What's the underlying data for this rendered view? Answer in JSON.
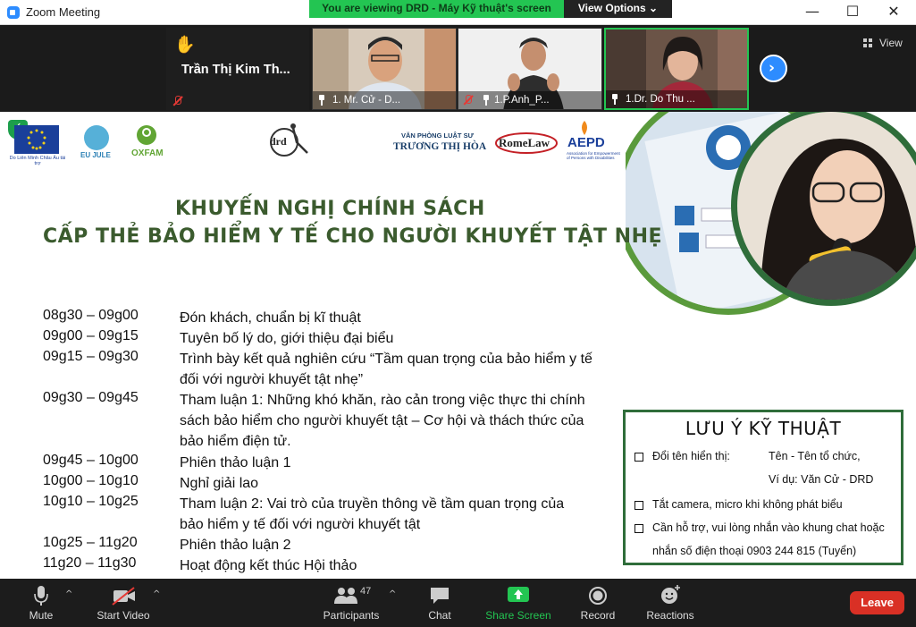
{
  "window": {
    "title": "Zoom Meeting",
    "viewing_banner": "You are viewing DRD - Máy Kỹ thuật's screen",
    "view_options_label": "View Options",
    "minimize": "—",
    "maximize": "☐",
    "close": "✕"
  },
  "participants_strip": {
    "raised_hand_name": "Trần Thị Kim Th...",
    "tiles": [
      {
        "name": "1. Mr. Cử - D..."
      },
      {
        "name": "1.P.Anh_P..."
      },
      {
        "name": "1.Dr. Do Thu ..."
      }
    ],
    "view_label": "View"
  },
  "slide": {
    "logos": {
      "eu_caption": "Do Liên Minh Châu Âu tài trợ",
      "eujule": "EU JULE",
      "oxfam": "OXFAM",
      "drd": "drd",
      "law_office_line1": "VĂN PHÒNG LUẬT SƯ",
      "law_office_line2": "TRƯƠNG THỊ HÒA",
      "romelaw": "RomeLaw",
      "aepd": "AEPD",
      "aepd_caption": "Association for Empowerment of Persons with Disabilities"
    },
    "title_line1": "KHUYẾN NGHỊ CHÍNH SÁCH",
    "title_line2": "CẤP THẺ BẢO HIỂM Y TẾ CHO NGƯỜI KHUYẾT TẬT NHẸ",
    "agenda": [
      {
        "time": "08g30 – 09g00",
        "text": "Đón khách, chuẩn bị kĩ thuật"
      },
      {
        "time": "09g00 – 09g15",
        "text": "Tuyên bố lý do, giới thiệu đại biểu"
      },
      {
        "time": "09g15 – 09g30",
        "text": "Trình bày kết quả nghiên cứu “Tầm quan trọng của bảo hiểm y tế đối với người khuyết tật nhẹ”"
      },
      {
        "time": "09g30 – 09g45",
        "text": "Tham luận 1: Những khó khăn, rào cản trong việc thực thi chính sách bảo hiểm cho người khuyết tật – Cơ hội và thách thức của bảo hiểm điện tử."
      },
      {
        "time": "09g45 – 10g00",
        "text": "Phiên thảo luận 1"
      },
      {
        "time": "10g00 – 10g10",
        "text": "Nghỉ giải lao"
      },
      {
        "time": "10g10 – 10g25",
        "text": "Tham luận 2: Vai trò của truyền thông về tầm quan trọng của bảo hiểm y tế đối với người khuyết tật"
      },
      {
        "time": "10g25 – 11g20",
        "text": "Phiên thảo luận 2"
      },
      {
        "time": "11g20 – 11g30",
        "text": "Hoạt động kết thúc Hội thảo"
      }
    ],
    "notes": {
      "title": "LƯU Ý KỸ THUẬT",
      "rename_label": "Đổi tên hiển thị:",
      "rename_format": "Tên - Tên tổ chức,",
      "rename_example": "Ví dụ: Văn Cử - DRD",
      "camera_note": "Tắt camera, micro khi không phát biểu",
      "help_line1": "Cần hỗ trợ, vui lòng nhắn vào khung chat hoặc",
      "help_line2": "nhắn số điện thoại 0903 244 815 (Tuyển)"
    }
  },
  "toolbar": {
    "mute": "Mute",
    "start_video": "Start Video",
    "participants": "Participants",
    "participant_count": "47",
    "chat": "Chat",
    "share_screen": "Share Screen",
    "record": "Record",
    "reactions": "Reactions",
    "leave": "Leave"
  },
  "colors": {
    "share_green": "#23c552",
    "slide_heading": "#3b5b2e",
    "notes_border": "#2f6d3a",
    "leave_red": "#d93025"
  }
}
